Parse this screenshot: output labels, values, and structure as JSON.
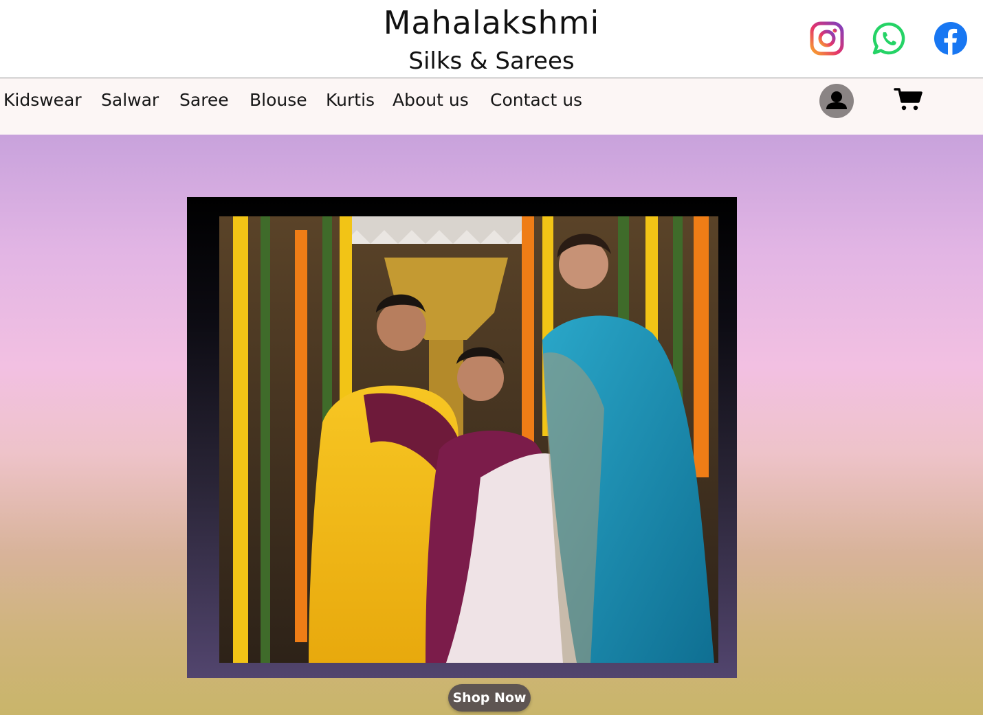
{
  "brand": {
    "name": "Mahalakshmi",
    "tagline": "Silks & Sarees"
  },
  "social": [
    {
      "icon": "instagram-icon"
    },
    {
      "icon": "whatsapp-icon"
    },
    {
      "icon": "facebook-icon"
    }
  ],
  "nav": {
    "items": [
      {
        "label": "Kidswear"
      },
      {
        "label": "Salwar"
      },
      {
        "label": "Saree"
      },
      {
        "label": "Blouse"
      },
      {
        "label": "Kurtis"
      },
      {
        "label": "About us"
      },
      {
        "label": "Contact us"
      }
    ],
    "account_icon": "user-icon",
    "cart_icon": "cart-icon"
  },
  "hero": {
    "cta_label": "Shop Now",
    "image": "three-women-in-silk-sarees-photo"
  },
  "colors": {
    "nav_background": "#fcf6f5",
    "cta_background": "#5e5552",
    "gradient_top": "#c8a2dc",
    "gradient_mid": "#f2c0e2",
    "gradient_bottom": "#c9b56a"
  }
}
